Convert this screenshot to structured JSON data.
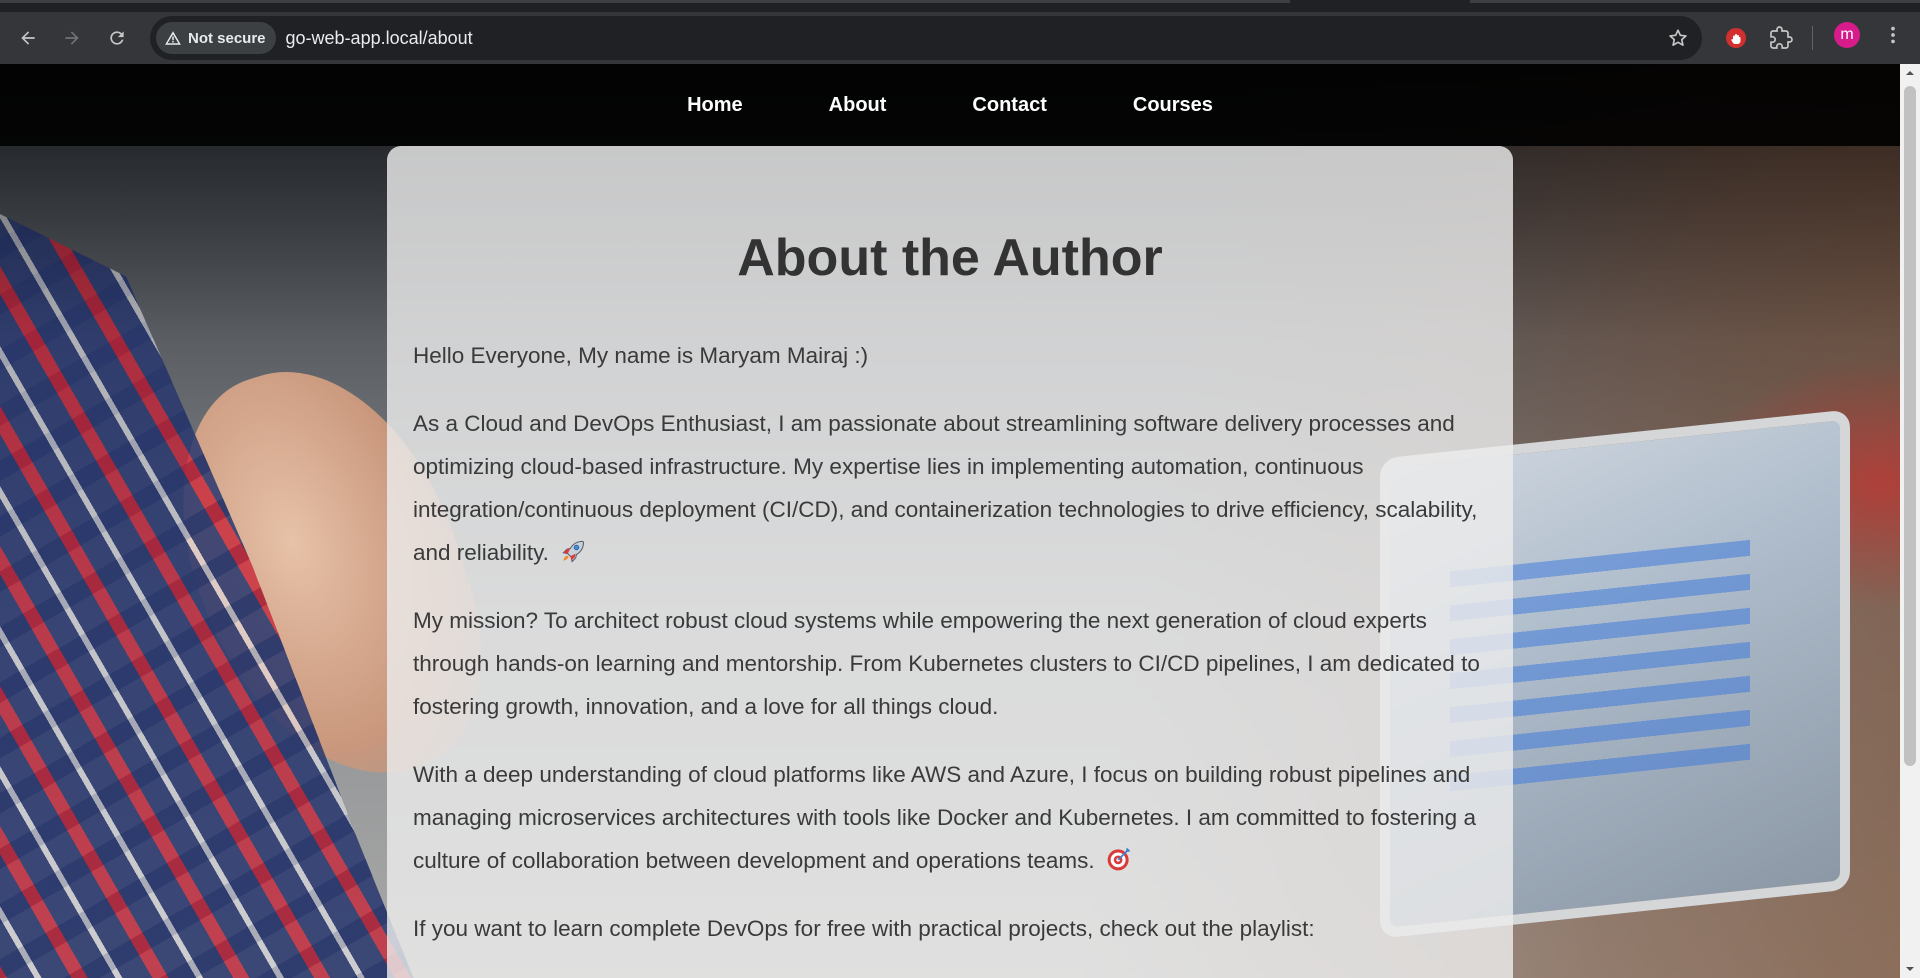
{
  "browser": {
    "security_label": "Not secure",
    "url_host": "go-web-app.local",
    "url_path": "/about",
    "avatar_letter": "m",
    "icons": {
      "back": "arrow-left-icon",
      "forward": "arrow-right-icon",
      "reload": "reload-icon",
      "warning": "warning-triangle-icon",
      "bookmark": "star-icon",
      "extension1": "red-hand-extension-icon",
      "extensions": "puzzle-icon",
      "menu": "kebab-menu-icon"
    }
  },
  "nav": {
    "items": [
      {
        "label": "Home"
      },
      {
        "label": "About"
      },
      {
        "label": "Contact"
      },
      {
        "label": "Courses"
      }
    ]
  },
  "content": {
    "title": "About the Author",
    "intro": "Hello Everyone, My name is Maryam Mairaj :)",
    "paragraph1": "As a Cloud and DevOps Enthusiast, I am passionate about streamlining software delivery processes and optimizing cloud-based infrastructure. My expertise lies in implementing automation, continuous integration/continuous deployment (CI/CD), and containerization technologies to drive efficiency, scalability, and reliability.",
    "paragraph1_emoji": "rocket-emoji",
    "paragraph2": "My mission? To architect robust cloud systems while empowering the next generation of cloud experts through hands-on learning and mentorship. From Kubernetes clusters to CI/CD pipelines, I am dedicated to fostering growth, innovation, and a love for all things cloud.",
    "paragraph3": "With a deep understanding of cloud platforms like AWS and Azure, I focus on building robust pipelines and managing microservices architectures with tools like Docker and Kubernetes. I am committed to fostering a culture of collaboration between development and operations teams.",
    "paragraph3_emoji": "target-emoji",
    "paragraph4": "If you want to learn complete DevOps for free with practical projects, check out the playlist:"
  },
  "colors": {
    "chrome_bg": "#35363a",
    "omnibox_bg": "#202124",
    "nav_bg": "#000000",
    "card_bg": "#ececec",
    "text": "#3a3a3a",
    "title": "#333333",
    "avatar": "#d81b8a"
  }
}
